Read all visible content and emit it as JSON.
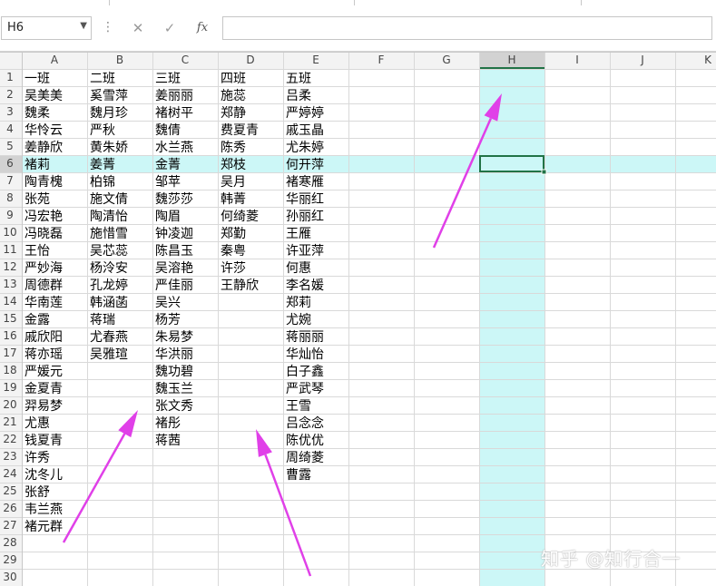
{
  "name_box": {
    "value": "H6"
  },
  "formula_bar": {
    "value": "",
    "fx_label": "fx",
    "cancel_icon": "x-icon",
    "enter_icon": "check-icon"
  },
  "columns": [
    "A",
    "B",
    "C",
    "D",
    "E",
    "F",
    "G",
    "H",
    "I",
    "J",
    "K"
  ],
  "selected": {
    "column": "H",
    "row": 6
  },
  "highlight_color": "#ccf7f7",
  "selection_border_color": "#217346",
  "arrow_color": "#e040e8",
  "rows": [
    [
      "一班",
      "二班",
      "三班",
      "四班",
      "五班"
    ],
    [
      "吴美美",
      "奚雪萍",
      "姜丽丽",
      "施蕊",
      "吕柔"
    ],
    [
      "魏柔",
      "魏月珍",
      "褚树平",
      "郑静",
      "严婷婷"
    ],
    [
      "华怜云",
      "严秋",
      "魏倩",
      "费夏青",
      "戚玉晶"
    ],
    [
      "姜静欣",
      "黄朱娇",
      "水兰燕",
      "陈秀",
      "尤朱婷"
    ],
    [
      "褚莉",
      "姜菁",
      "金菁",
      "郑枝",
      "何开萍"
    ],
    [
      "陶青槐",
      "柏锦",
      "邹苹",
      "吴月",
      "褚寒雁"
    ],
    [
      "张苑",
      "施文倩",
      "魏莎莎",
      "韩菁",
      "华丽红"
    ],
    [
      "冯宏艳",
      "陶清怡",
      "陶眉",
      "何绮菱",
      "孙丽红"
    ],
    [
      "冯晓磊",
      "施惜雪",
      "钟凌迦",
      "郑勤",
      "王雁"
    ],
    [
      "王怡",
      "吴芯蕊",
      "陈昌玉",
      "秦粤",
      "许亚萍"
    ],
    [
      "严妙海",
      "杨泠安",
      "吴溶艳",
      "许莎",
      "何惠"
    ],
    [
      "周德群",
      "孔龙婷",
      "严佳丽",
      "王静欣",
      "李名媛"
    ],
    [
      "华南莲",
      "韩涵菡",
      "吴兴",
      "",
      "郑莉"
    ],
    [
      "金露",
      "蒋瑞",
      "杨芳",
      "",
      "尤婉"
    ],
    [
      "戚欣阳",
      "尤春燕",
      "朱易梦",
      "",
      "蒋丽丽"
    ],
    [
      "蒋亦瑶",
      "吴雅瑄",
      "华洪丽",
      "",
      "华灿怡"
    ],
    [
      "严媛元",
      "",
      "魏功碧",
      "",
      "白子鑫"
    ],
    [
      "金夏青",
      "",
      "魏玉兰",
      "",
      "严武琴"
    ],
    [
      "羿易梦",
      "",
      "张文秀",
      "",
      "王雪"
    ],
    [
      "尤惠",
      "",
      "褚彤",
      "",
      "吕念念"
    ],
    [
      "钱夏青",
      "",
      "蒋茜",
      "",
      "陈优优"
    ],
    [
      "许秀",
      "",
      "",
      "",
      "周绮菱"
    ],
    [
      "沈冬儿",
      "",
      "",
      "",
      "曹露"
    ],
    [
      "张舒",
      "",
      "",
      "",
      ""
    ],
    [
      "韦兰燕",
      "",
      "",
      "",
      ""
    ],
    [
      "褚元群",
      "",
      "",
      "",
      ""
    ],
    [
      "",
      "",
      "",
      "",
      ""
    ],
    [
      "",
      "",
      "",
      "",
      ""
    ],
    [
      "",
      "",
      "",
      "",
      ""
    ]
  ],
  "watermark": "知乎 @知行合一"
}
